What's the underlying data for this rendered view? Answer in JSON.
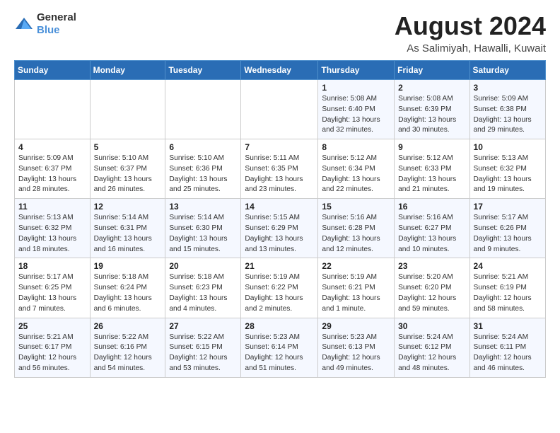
{
  "header": {
    "logo_general": "General",
    "logo_blue": "Blue",
    "month_year": "August 2024",
    "location": "As Salimiyah, Hawalli, Kuwait"
  },
  "days_of_week": [
    "Sunday",
    "Monday",
    "Tuesday",
    "Wednesday",
    "Thursday",
    "Friday",
    "Saturday"
  ],
  "weeks": [
    [
      {
        "day": "",
        "info": ""
      },
      {
        "day": "",
        "info": ""
      },
      {
        "day": "",
        "info": ""
      },
      {
        "day": "",
        "info": ""
      },
      {
        "day": "1",
        "info": "Sunrise: 5:08 AM\nSunset: 6:40 PM\nDaylight: 13 hours\nand 32 minutes."
      },
      {
        "day": "2",
        "info": "Sunrise: 5:08 AM\nSunset: 6:39 PM\nDaylight: 13 hours\nand 30 minutes."
      },
      {
        "day": "3",
        "info": "Sunrise: 5:09 AM\nSunset: 6:38 PM\nDaylight: 13 hours\nand 29 minutes."
      }
    ],
    [
      {
        "day": "4",
        "info": "Sunrise: 5:09 AM\nSunset: 6:37 PM\nDaylight: 13 hours\nand 28 minutes."
      },
      {
        "day": "5",
        "info": "Sunrise: 5:10 AM\nSunset: 6:37 PM\nDaylight: 13 hours\nand 26 minutes."
      },
      {
        "day": "6",
        "info": "Sunrise: 5:10 AM\nSunset: 6:36 PM\nDaylight: 13 hours\nand 25 minutes."
      },
      {
        "day": "7",
        "info": "Sunrise: 5:11 AM\nSunset: 6:35 PM\nDaylight: 13 hours\nand 23 minutes."
      },
      {
        "day": "8",
        "info": "Sunrise: 5:12 AM\nSunset: 6:34 PM\nDaylight: 13 hours\nand 22 minutes."
      },
      {
        "day": "9",
        "info": "Sunrise: 5:12 AM\nSunset: 6:33 PM\nDaylight: 13 hours\nand 21 minutes."
      },
      {
        "day": "10",
        "info": "Sunrise: 5:13 AM\nSunset: 6:32 PM\nDaylight: 13 hours\nand 19 minutes."
      }
    ],
    [
      {
        "day": "11",
        "info": "Sunrise: 5:13 AM\nSunset: 6:32 PM\nDaylight: 13 hours\nand 18 minutes."
      },
      {
        "day": "12",
        "info": "Sunrise: 5:14 AM\nSunset: 6:31 PM\nDaylight: 13 hours\nand 16 minutes."
      },
      {
        "day": "13",
        "info": "Sunrise: 5:14 AM\nSunset: 6:30 PM\nDaylight: 13 hours\nand 15 minutes."
      },
      {
        "day": "14",
        "info": "Sunrise: 5:15 AM\nSunset: 6:29 PM\nDaylight: 13 hours\nand 13 minutes."
      },
      {
        "day": "15",
        "info": "Sunrise: 5:16 AM\nSunset: 6:28 PM\nDaylight: 13 hours\nand 12 minutes."
      },
      {
        "day": "16",
        "info": "Sunrise: 5:16 AM\nSunset: 6:27 PM\nDaylight: 13 hours\nand 10 minutes."
      },
      {
        "day": "17",
        "info": "Sunrise: 5:17 AM\nSunset: 6:26 PM\nDaylight: 13 hours\nand 9 minutes."
      }
    ],
    [
      {
        "day": "18",
        "info": "Sunrise: 5:17 AM\nSunset: 6:25 PM\nDaylight: 13 hours\nand 7 minutes."
      },
      {
        "day": "19",
        "info": "Sunrise: 5:18 AM\nSunset: 6:24 PM\nDaylight: 13 hours\nand 6 minutes."
      },
      {
        "day": "20",
        "info": "Sunrise: 5:18 AM\nSunset: 6:23 PM\nDaylight: 13 hours\nand 4 minutes."
      },
      {
        "day": "21",
        "info": "Sunrise: 5:19 AM\nSunset: 6:22 PM\nDaylight: 13 hours\nand 2 minutes."
      },
      {
        "day": "22",
        "info": "Sunrise: 5:19 AM\nSunset: 6:21 PM\nDaylight: 13 hours\nand 1 minute."
      },
      {
        "day": "23",
        "info": "Sunrise: 5:20 AM\nSunset: 6:20 PM\nDaylight: 12 hours\nand 59 minutes."
      },
      {
        "day": "24",
        "info": "Sunrise: 5:21 AM\nSunset: 6:19 PM\nDaylight: 12 hours\nand 58 minutes."
      }
    ],
    [
      {
        "day": "25",
        "info": "Sunrise: 5:21 AM\nSunset: 6:17 PM\nDaylight: 12 hours\nand 56 minutes."
      },
      {
        "day": "26",
        "info": "Sunrise: 5:22 AM\nSunset: 6:16 PM\nDaylight: 12 hours\nand 54 minutes."
      },
      {
        "day": "27",
        "info": "Sunrise: 5:22 AM\nSunset: 6:15 PM\nDaylight: 12 hours\nand 53 minutes."
      },
      {
        "day": "28",
        "info": "Sunrise: 5:23 AM\nSunset: 6:14 PM\nDaylight: 12 hours\nand 51 minutes."
      },
      {
        "day": "29",
        "info": "Sunrise: 5:23 AM\nSunset: 6:13 PM\nDaylight: 12 hours\nand 49 minutes."
      },
      {
        "day": "30",
        "info": "Sunrise: 5:24 AM\nSunset: 6:12 PM\nDaylight: 12 hours\nand 48 minutes."
      },
      {
        "day": "31",
        "info": "Sunrise: 5:24 AM\nSunset: 6:11 PM\nDaylight: 12 hours\nand 46 minutes."
      }
    ]
  ]
}
